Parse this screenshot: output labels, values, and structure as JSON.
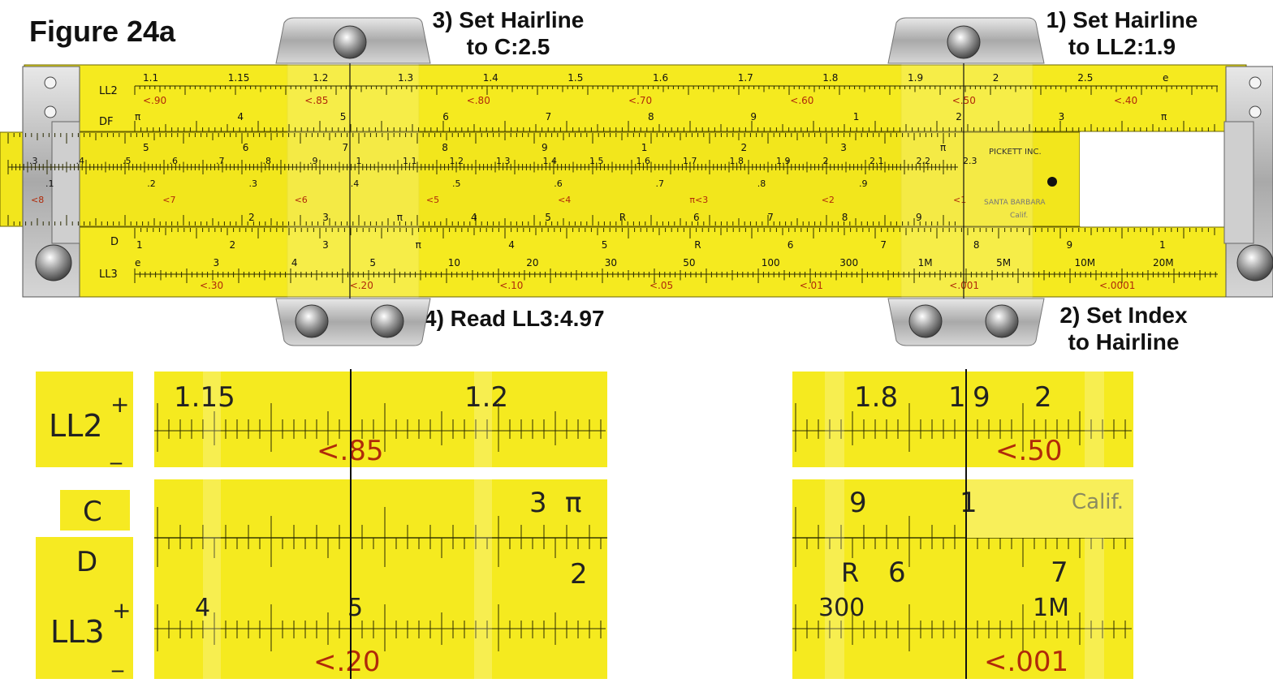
{
  "figure": {
    "title": "Figure 24a"
  },
  "steps": {
    "step1_line1": "1) Set Hairline",
    "step1_line2": "to LL2:1.9",
    "step2_line1": "2) Set Index",
    "step2_line2": "to Hairline",
    "step3_line1": "3) Set Hairline",
    "step3_line2": "to C:2.5",
    "step4": "4) Read LL3:4.97"
  },
  "rule": {
    "scale_names": {
      "ll2": "LL2",
      "df": "DF",
      "d": "D",
      "ll3": "LL3",
      "c": "C"
    },
    "slide_text": {
      "maker": "PICKETT INC.",
      "city": "SANTA BARBARA",
      "state": "Calif."
    },
    "ll2_labels": [
      "1.1",
      "1.15",
      "1.2",
      "1.3",
      "1.4",
      "1.5",
      "1.6",
      "1.7",
      "1.8",
      "1.9",
      "2",
      "2.5",
      "e"
    ],
    "ll2_red": [
      "<.90",
      "<.85",
      "<.80",
      "<.70",
      "<.60",
      "<.50",
      "<.40"
    ],
    "df_labels": [
      "π",
      "4",
      "5",
      "6",
      "7",
      "8",
      "9",
      "1",
      "2",
      "3",
      "π"
    ],
    "cf_labels": [
      "5",
      "6",
      "7",
      "8",
      "9",
      "1",
      "2",
      "3",
      "π"
    ],
    "mid_labels": [
      ".3",
      ".4",
      ".5",
      ".6",
      ".7",
      ".8",
      ".9",
      "1",
      "1.1",
      "1.2",
      "1.3",
      "1.4",
      "1.5",
      "1.6",
      "1.7",
      "1.8",
      "1.9",
      "2",
      "2.1",
      "2.2",
      "2.3"
    ],
    "lower_slide_labels": [
      ".1",
      ".2",
      ".3",
      ".4",
      ".5",
      ".6",
      ".7",
      ".8",
      ".9"
    ],
    "lower_slide_red": [
      "<8",
      "<7",
      "<6",
      "<5",
      "<4",
      "π<3",
      "<2",
      "<1"
    ],
    "c_labels": [
      "2",
      "3",
      "π",
      "4",
      "5",
      "R",
      "6",
      "7",
      "8",
      "9"
    ],
    "d_labels": [
      "1",
      "2",
      "3",
      "π",
      "4",
      "5",
      "R",
      "6",
      "7",
      "8",
      "9",
      "1"
    ],
    "ll3_labels": [
      "e",
      "3",
      "4",
      "5",
      "10",
      "20",
      "30",
      "50",
      "100",
      "300",
      "1M",
      "5M",
      "10M",
      "20M"
    ],
    "ll3_red": [
      "<.30",
      "<.20",
      "<.10",
      "<.05",
      "<.01",
      "<.001",
      "<.0001"
    ]
  },
  "zoom_left": {
    "ll2_labels": [
      "1.15",
      "1.2"
    ],
    "ll2_red": "<.85",
    "c_labels": [
      "3",
      "π"
    ],
    "d_label": "2",
    "ll3_labels": [
      "4",
      "5"
    ],
    "ll3_red": "<.20"
  },
  "zoom_right": {
    "ll2_labels": [
      "1.8",
      "1",
      "9",
      "2"
    ],
    "ll2_red": "<.50",
    "c_labels": [
      "9",
      "1"
    ],
    "calif": "Calif.",
    "d_labels": [
      "R",
      "6",
      "7"
    ],
    "ll3_labels": [
      "300",
      "1M"
    ],
    "ll3_red": "<.001"
  }
}
